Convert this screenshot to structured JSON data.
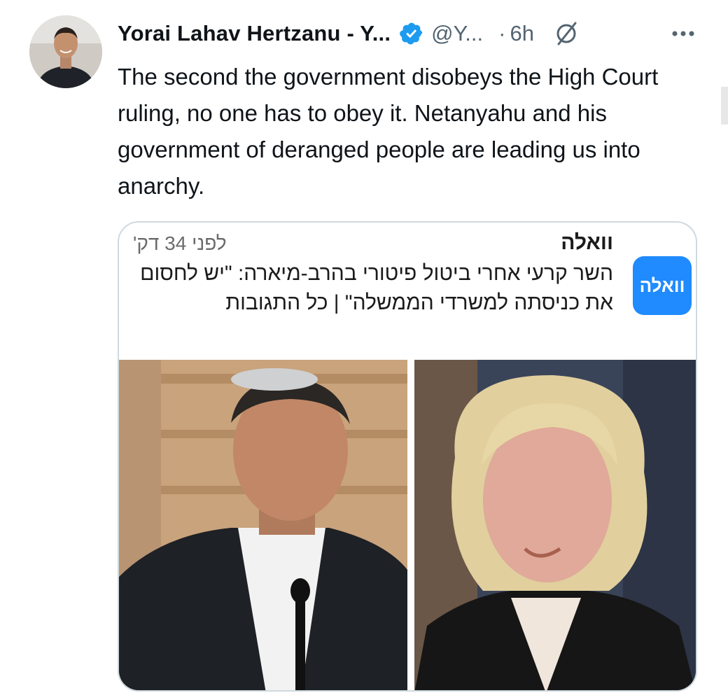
{
  "tweet": {
    "author_name": "Yorai Lahav Hertzanu - Y...",
    "handle": "@Y...",
    "separator": "·",
    "time": "6h",
    "text": "The second the government disobeys the High Court ruling, no one has to obey it. Netanyahu and his government of deranged people are leading us into anarchy."
  },
  "card": {
    "source": "וואלה",
    "time_ago": "לפני 34 דק'",
    "headline": "השר קרעי אחרי ביטול פיטורי בהרב-מיארה: \"יש לחסום את כניסתה למשרדי הממשלה\" | כל התגובות",
    "logo_text": "וואלה"
  },
  "icons": {
    "verified": "verified-badge-icon",
    "grok": "grok-icon",
    "more": "more-options-icon"
  },
  "colors": {
    "verified_blue": "#1d9bf0",
    "logo_blue": "#1f8bff",
    "secondary_text": "#536471"
  }
}
